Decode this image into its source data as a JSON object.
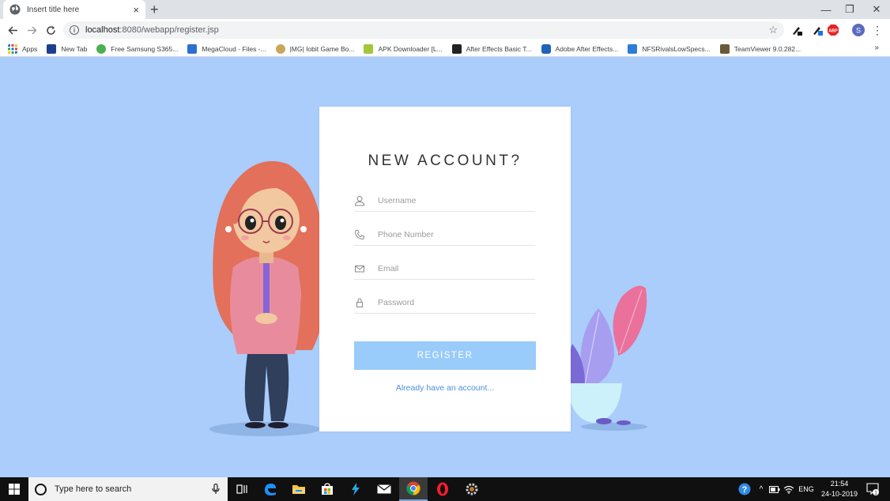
{
  "browser": {
    "tab_title": "Insert title here",
    "tab_close": "×",
    "new_tab": "+",
    "url_host": "localhost",
    "url_path": ":8080/webapp/register.jsp",
    "window_controls": {
      "minimize": "—",
      "restore": "❐",
      "close": "✕"
    },
    "extensions": [
      {
        "name": "pen-extension-icon"
      },
      {
        "name": "pen-extension-2-icon"
      },
      {
        "name": "adblock-plus-icon",
        "label": "ABP"
      },
      {
        "name": "profile-avatar",
        "label": "S"
      }
    ]
  },
  "bookmarks": {
    "items": [
      {
        "label": "Apps",
        "icon": "apps-grid-icon",
        "color": "#1a73e8"
      },
      {
        "label": "New Tab",
        "icon": "newtab-icon",
        "color": "#1c3f8f"
      },
      {
        "label": "Free Samsung S365...",
        "icon": "samsung-icon",
        "color": "#4caf50"
      },
      {
        "label": "MegaCloud - Files -...",
        "icon": "megacloud-icon",
        "color": "#2c6fd1"
      },
      {
        "label": "|MG| Iobit Game Bo...",
        "icon": "iobit-icon",
        "color": "#caa65a"
      },
      {
        "label": "APK Downloader [L...",
        "icon": "apk-icon",
        "color": "#a4c639"
      },
      {
        "label": "After Effects Basic T...",
        "icon": "v-icon",
        "color": "#222222"
      },
      {
        "label": "Adobe After Effects...",
        "icon": "adobe-ae-icon",
        "color": "#1e63b8"
      },
      {
        "label": "NFSRivalsLowSpecs...",
        "icon": "nfs-icon",
        "color": "#2c7cd8"
      },
      {
        "label": "TeamViewer 9.0.282...",
        "icon": "teamviewer-icon",
        "color": "#6b5a3a"
      }
    ],
    "more": "»"
  },
  "form": {
    "title": "NEW ACCOUNT?",
    "username_placeholder": "Username",
    "phone_placeholder": "Phone Number",
    "email_placeholder": "Email",
    "password_placeholder": "Password",
    "register_label": "REGISTER",
    "login_link": "Already have an account..."
  },
  "taskbar": {
    "search_placeholder": "Type here to search",
    "language": "ENG",
    "time": "21:54",
    "date": "24-10-2019",
    "notification_count": "1"
  },
  "colors": {
    "page_bg": "#aacdfb",
    "button_bg": "#99cbfb",
    "link": "#4a90e2"
  }
}
